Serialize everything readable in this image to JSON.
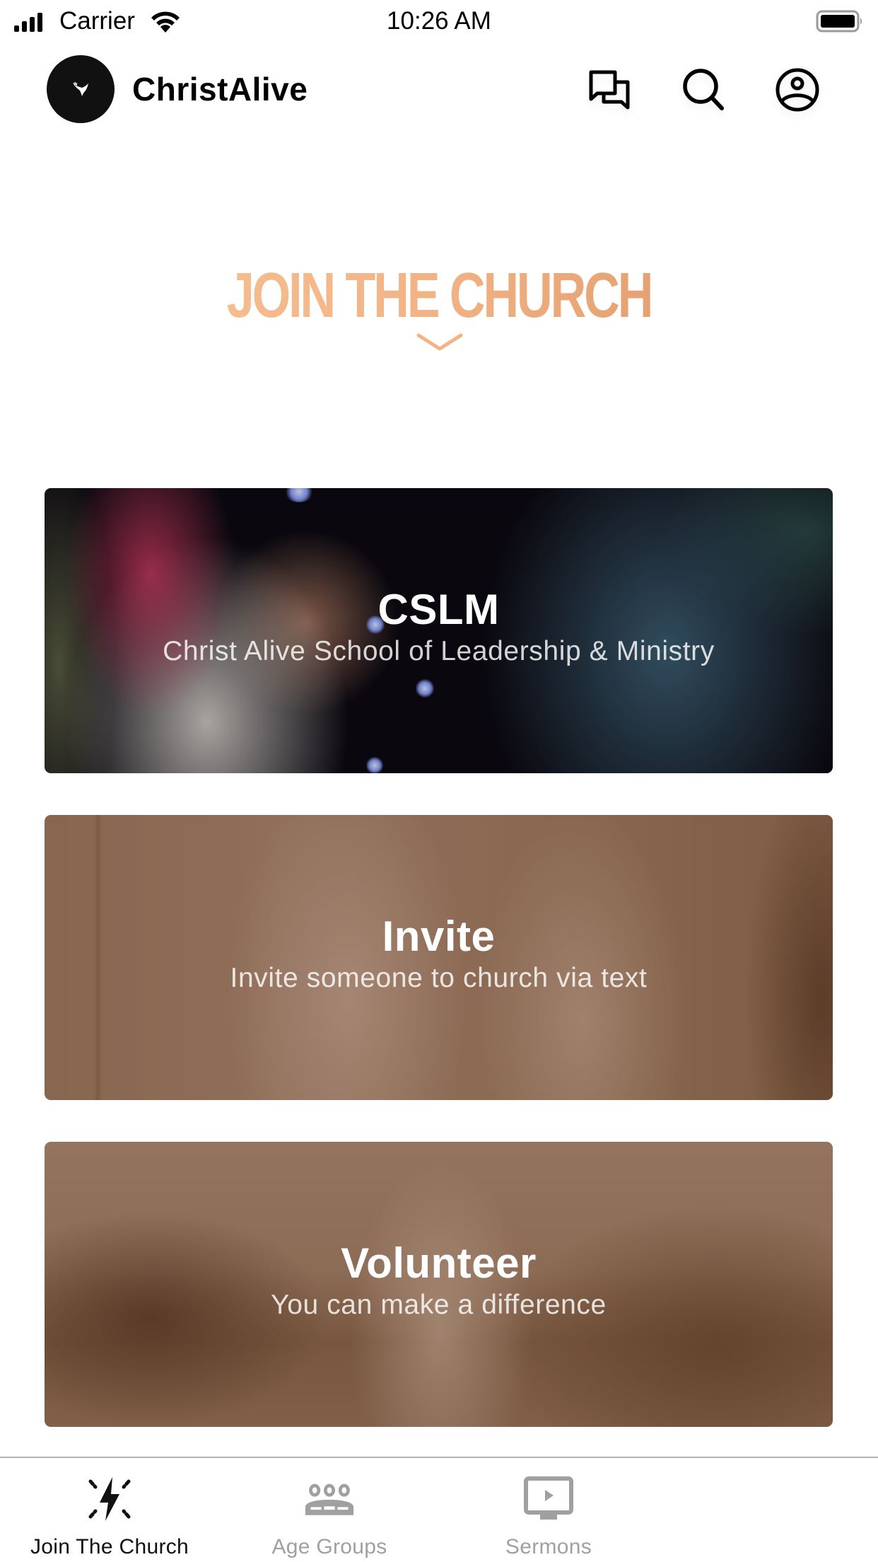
{
  "status_bar": {
    "carrier": "Carrier",
    "time": "10:26 AM",
    "signal_icon": "cellular-signal-icon",
    "wifi_icon": "wifi-icon",
    "battery_icon": "battery-full-icon"
  },
  "header": {
    "logo_icon": "dove-logo-icon",
    "app_title": "ChristAlive",
    "actions": [
      {
        "name": "messages",
        "icon": "chat-bubbles-icon"
      },
      {
        "name": "search",
        "icon": "search-icon"
      },
      {
        "name": "profile",
        "icon": "user-circle-icon"
      }
    ]
  },
  "section": {
    "title": "JOIN THE CHURCH",
    "title_gradient": [
      "#f6bc8e",
      "#e6a172"
    ],
    "chevron_icon": "chevron-down-icon"
  },
  "cards": [
    {
      "title": "CSLM",
      "subtitle": "Christ Alive School of Leadership & Ministry"
    },
    {
      "title": "Invite",
      "subtitle": "Invite someone to church via text"
    },
    {
      "title": "Volunteer",
      "subtitle": "You can make a difference"
    }
  ],
  "tab_bar": {
    "active_color": "#111111",
    "inactive_color": "#a0a0a0",
    "tabs": [
      {
        "label": "Join The Church",
        "icon": "lightning-spark-icon",
        "active": true
      },
      {
        "label": "Age Groups",
        "icon": "group-people-icon",
        "active": false
      },
      {
        "label": "Sermons",
        "icon": "video-monitor-icon",
        "active": false
      }
    ]
  }
}
